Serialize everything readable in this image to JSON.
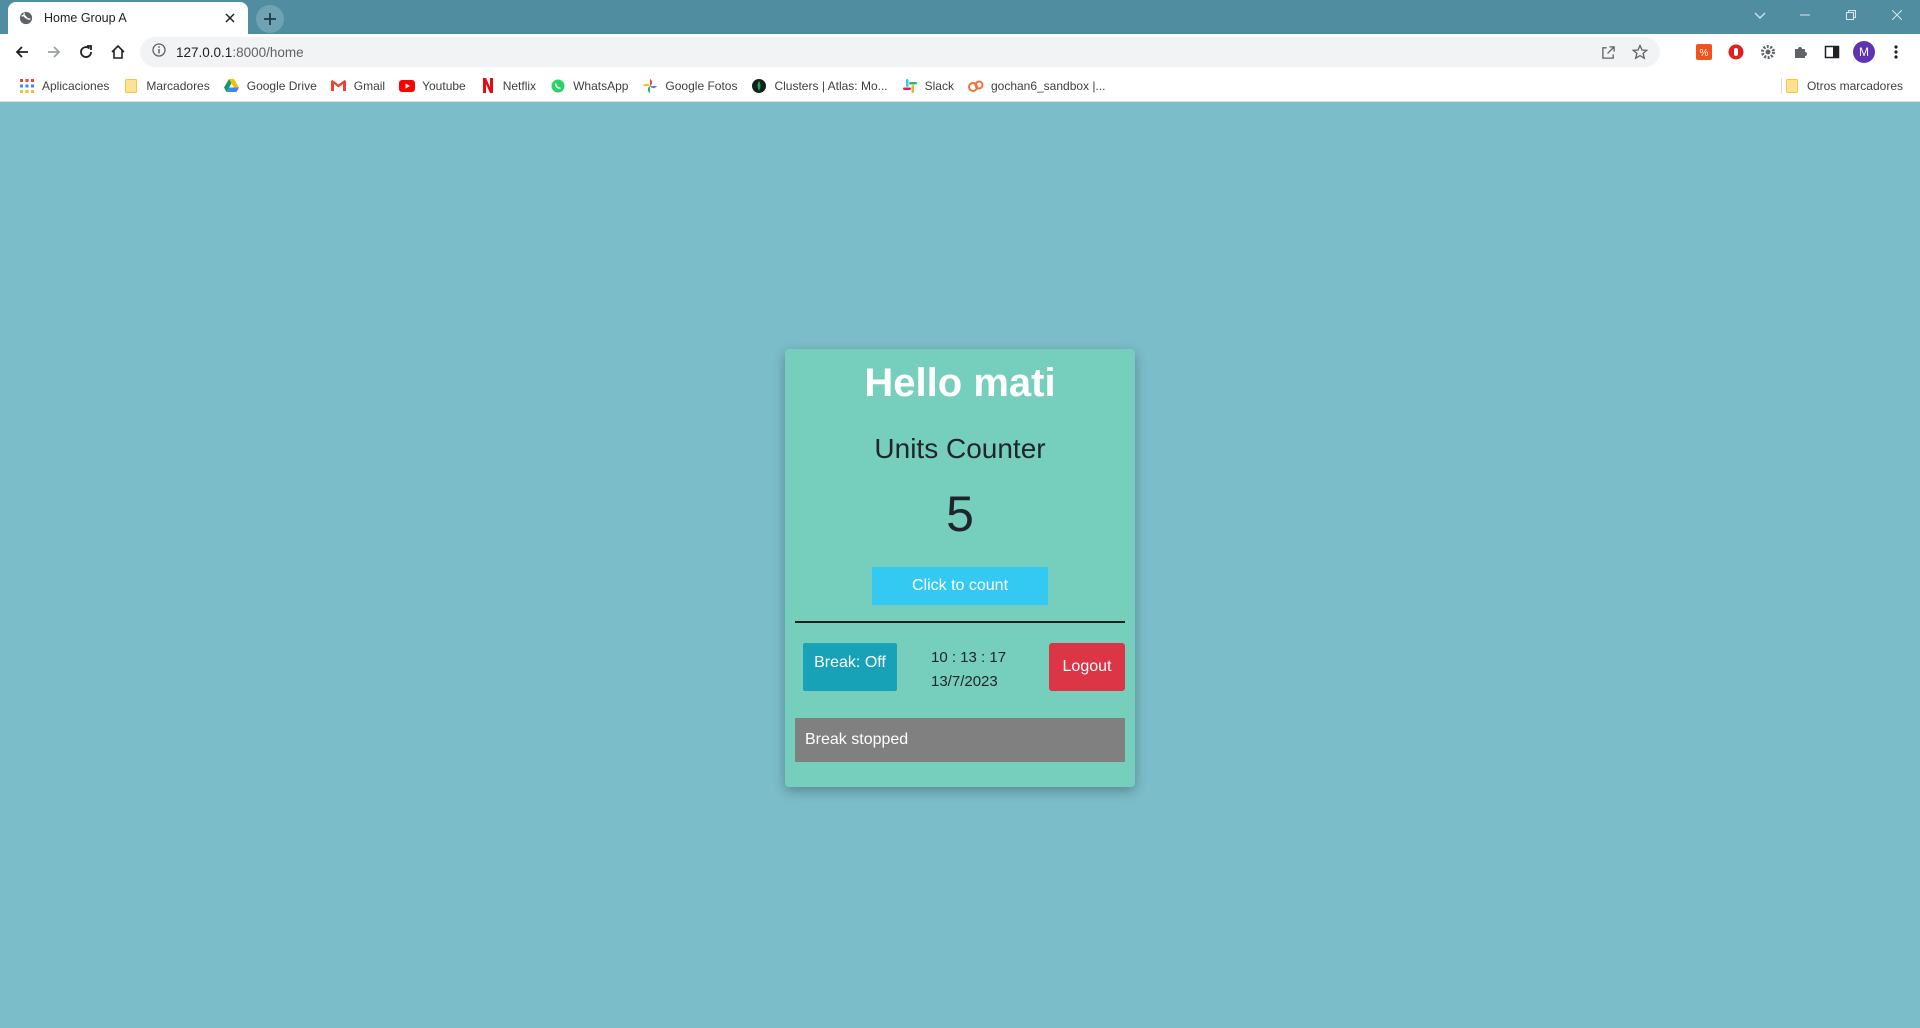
{
  "browser": {
    "tab": {
      "title": "Home Group A",
      "favicon": "globe-icon"
    },
    "url": {
      "host": "127.0.0.1",
      "path": ":8000/home"
    },
    "profile_initial": "M",
    "bookmarks": [
      {
        "label": "Aplicaciones",
        "icon": "apps-grid-icon"
      },
      {
        "label": "Marcadores",
        "icon": "folder-icon"
      },
      {
        "label": "Google Drive",
        "icon": "google-drive-icon"
      },
      {
        "label": "Gmail",
        "icon": "gmail-icon"
      },
      {
        "label": "Youtube",
        "icon": "youtube-icon"
      },
      {
        "label": "Netflix",
        "icon": "netflix-icon"
      },
      {
        "label": "WhatsApp",
        "icon": "whatsapp-icon"
      },
      {
        "label": "Google Fotos",
        "icon": "google-photos-icon"
      },
      {
        "label": "Clusters | Atlas: Mo...",
        "icon": "mongodb-icon"
      },
      {
        "label": "Slack",
        "icon": "slack-icon"
      },
      {
        "label": "gochan6_sandbox |...",
        "icon": "postman-icon"
      }
    ],
    "other_bookmarks": "Otros marcadores"
  },
  "page": {
    "greeting": "Hello mati",
    "subtitle": "Units Counter",
    "count": "5",
    "count_button": "Click to count",
    "break_button": "Break: Off",
    "time": "10 : 13 : 17",
    "date": "13/7/2023",
    "logout_button": "Logout",
    "status": "Break stopped"
  },
  "colors": {
    "page_background": "#7bbdc9",
    "card_background": "#76cfbd",
    "count_button": "#33c9f0",
    "break_button": "#17a2b8",
    "logout_button": "#dc3545",
    "status_background": "#808080"
  }
}
